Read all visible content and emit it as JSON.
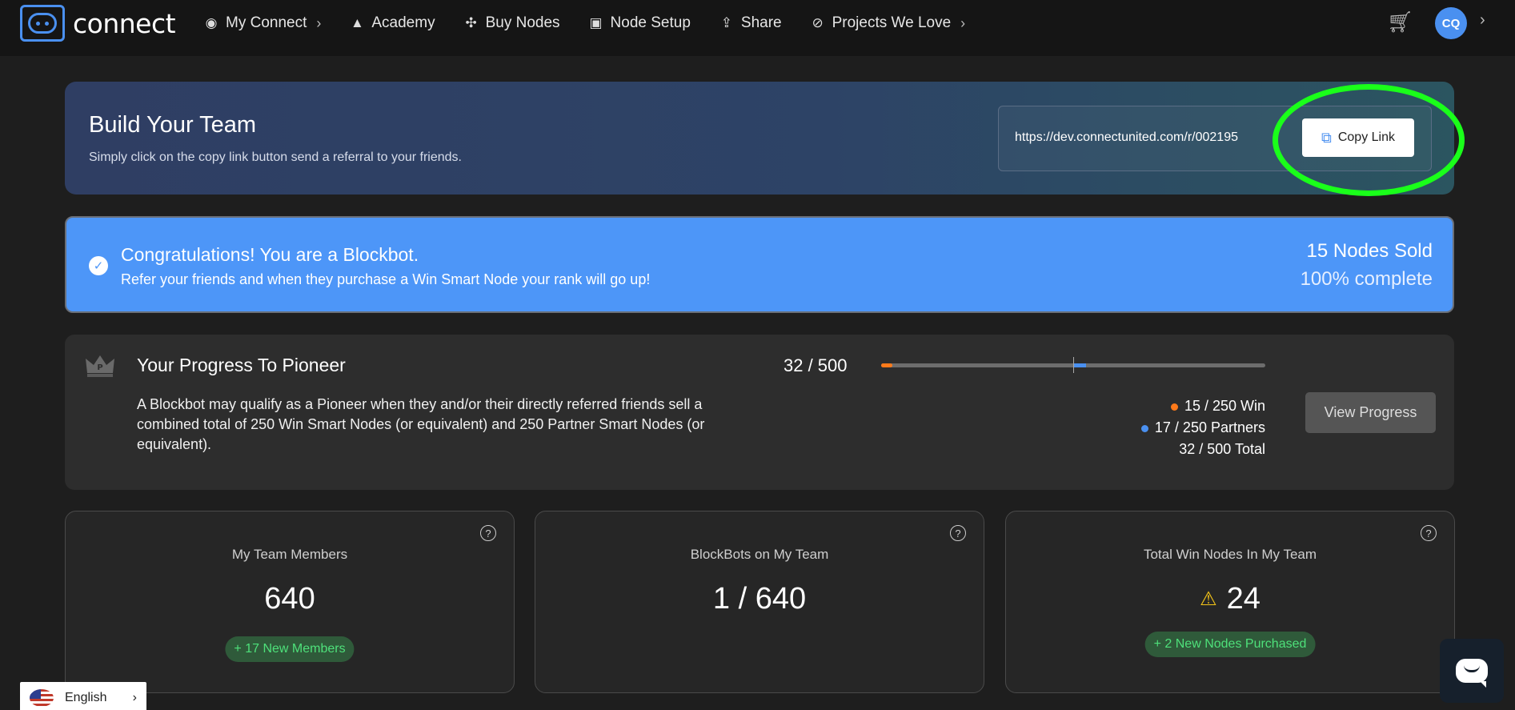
{
  "nav": {
    "logo_text": "connect",
    "items": [
      {
        "label": "My Connect",
        "icon": "eye-icon",
        "glyph": "◉",
        "chevron": true
      },
      {
        "label": "Academy",
        "icon": "graduation-cap-icon",
        "glyph": "🎓",
        "chevron": false
      },
      {
        "label": "Buy Nodes",
        "icon": "nodes-icon",
        "glyph": "✣",
        "chevron": false
      },
      {
        "label": "Node Setup",
        "icon": "help-square-icon",
        "glyph": "▣",
        "chevron": false
      },
      {
        "label": "Share",
        "icon": "share-upload-icon",
        "glyph": "⇪",
        "chevron": false
      },
      {
        "label": "Projects We Love",
        "icon": "compass-icon",
        "glyph": "⊘",
        "chevron": true
      }
    ],
    "avatar_initials": "CQ"
  },
  "build": {
    "title": "Build Your Team",
    "subtitle": "Simply click on the copy link button send a referral to your friends.",
    "referral_url": "https://dev.connectunited.com/r/002195",
    "copy_label": "Copy Link"
  },
  "congrats": {
    "title": "Congratulations! You are a Blockbot.",
    "message": "Refer your friends and when they purchase a Win Smart Node your rank will go up!",
    "nodes_sold": "15 Nodes Sold",
    "percent": "100% complete"
  },
  "progress": {
    "title": "Your Progress To Pioneer",
    "description": "A Blockbot may qualify as a Pioneer when they and/or their directly referred friends sell a combined total of 250 Win Smart Nodes (or equivalent) and 250 Partner Smart Nodes (or equivalent).",
    "ratio": "32 / 500",
    "win_text": "15 / 250 Win",
    "partners_text": "17 / 250 Partners",
    "total_text": "32 / 500 Total",
    "win_value": 15,
    "partners_value": 17,
    "total_max": 500,
    "win_color": "#ff7a1a",
    "partners_color": "#4a90f0",
    "view_label": "View Progress"
  },
  "cards": [
    {
      "label": "My Team Members",
      "value": "640",
      "badge": "+ 17 New Members",
      "warn": false
    },
    {
      "label": "BlockBots on My Team",
      "value": "1 / 640",
      "badge": "",
      "warn": false
    },
    {
      "label": "Total Win Nodes In My Team",
      "value": "24",
      "badge": "+ 2 New Nodes Purchased",
      "warn": true
    }
  ],
  "language": {
    "label": "English"
  }
}
